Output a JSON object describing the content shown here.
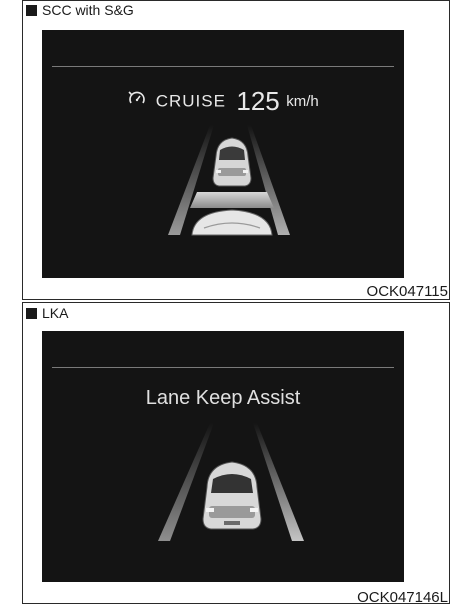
{
  "sections": [
    {
      "title": "SCC with S&G",
      "display": {
        "cruise_label": "CRUISE",
        "speed": "125",
        "unit": "km/h"
      },
      "code": "OCK047115"
    },
    {
      "title": "LKA",
      "display": {
        "message": "Lane Keep Assist"
      },
      "code": "OCK047146L"
    }
  ]
}
